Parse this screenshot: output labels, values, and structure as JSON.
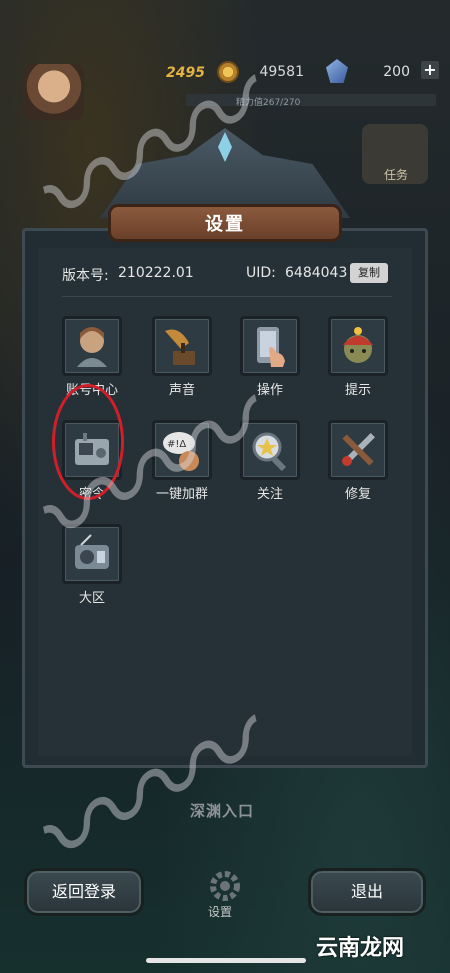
{
  "hud": {
    "level": "2495",
    "gold": "49581",
    "gems": "200",
    "plus": "+",
    "energy": "精力值267/270",
    "task_label": "任务"
  },
  "dialog": {
    "title": "设置",
    "version_label": "版本号:",
    "version_value": "210222.01",
    "uid_label": "UID:",
    "uid_value": "6484043",
    "copy_label": "复制",
    "items": [
      {
        "label": "账号中心",
        "icon": "account-icon"
      },
      {
        "label": "声音",
        "icon": "gramophone-icon"
      },
      {
        "label": "操作",
        "icon": "phone-tap-icon"
      },
      {
        "label": "提示",
        "icon": "helmet-icon"
      },
      {
        "label": "密令",
        "icon": "radio-device-icon"
      },
      {
        "label": "一键加群",
        "icon": "chat-bubble-icon"
      },
      {
        "label": "关注",
        "icon": "magnifier-star-icon"
      },
      {
        "label": "修复",
        "icon": "tools-icon"
      },
      {
        "label": "大区",
        "icon": "radio-icon"
      }
    ]
  },
  "background_label": "深渊入口",
  "footer": {
    "back_label": "返回登录",
    "settings_label": "设置",
    "exit_label": "退出"
  },
  "corner_watermark": "云南龙网",
  "colors": {
    "highlight_circle": "#d11f2a",
    "gold_text": "#e3b343"
  }
}
